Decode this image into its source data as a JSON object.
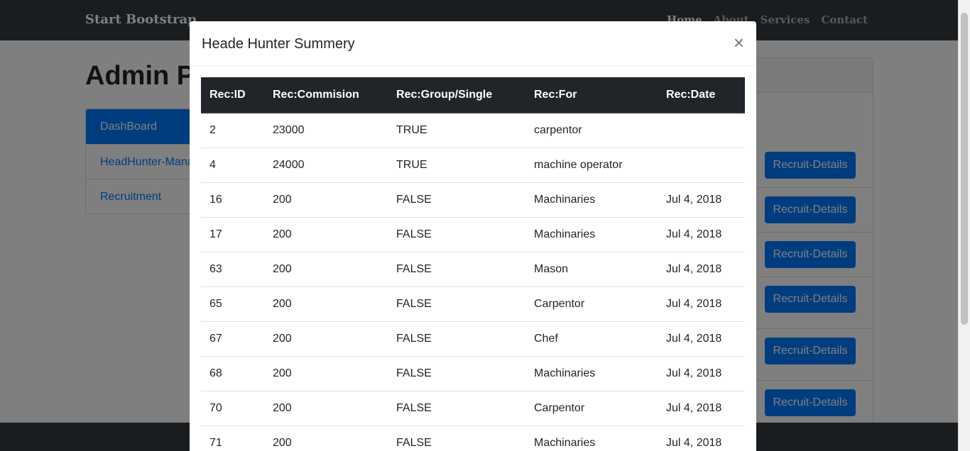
{
  "navbar": {
    "brand": "Start Bootstrap",
    "links": [
      {
        "label": "Home"
      },
      {
        "label": "About"
      },
      {
        "label": "Services"
      },
      {
        "label": "Contact"
      }
    ]
  },
  "page": {
    "title": "Admin Panel",
    "sidebar": [
      {
        "label": "DashBoard"
      },
      {
        "label": "HeadHunter-Management"
      },
      {
        "label": "Recruitment"
      }
    ],
    "recruit_button_label": "Recruit-Details"
  },
  "modal": {
    "title": "Heade Hunter Summery",
    "close_label": "×",
    "columns": [
      "Rec:ID",
      "Rec:Commision",
      "Rec:Group/Single",
      "Rec:For",
      "Rec:Date"
    ],
    "rows": [
      [
        "2",
        "23000",
        "TRUE",
        "carpentor",
        ""
      ],
      [
        "4",
        "24000",
        "TRUE",
        "machine operator",
        ""
      ],
      [
        "16",
        "200",
        "FALSE",
        "Machinaries",
        "Jul 4, 2018"
      ],
      [
        "17",
        "200",
        "FALSE",
        "Machinaries",
        "Jul 4, 2018"
      ],
      [
        "63",
        "200",
        "FALSE",
        "Mason",
        "Jul 4, 2018"
      ],
      [
        "65",
        "200",
        "FALSE",
        "Carpentor",
        "Jul 4, 2018"
      ],
      [
        "67",
        "200",
        "FALSE",
        "Chef",
        "Jul 4, 2018"
      ],
      [
        "68",
        "200",
        "FALSE",
        "Machinaries",
        "Jul 4, 2018"
      ],
      [
        "70",
        "200",
        "FALSE",
        "Carpentor",
        "Jul 4, 2018"
      ],
      [
        "71",
        "200",
        "FALSE",
        "Machinaries",
        "Jul 4, 2018"
      ]
    ]
  }
}
